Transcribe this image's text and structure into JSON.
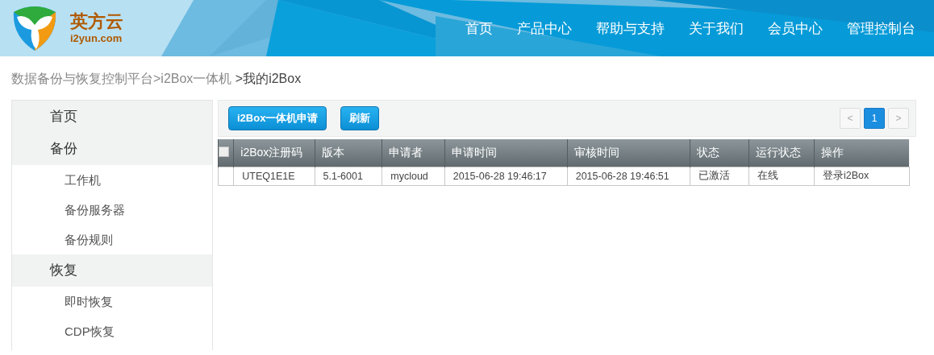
{
  "logo": {
    "name": "英方云",
    "domain": "i2yun.com"
  },
  "nav": [
    {
      "label": "首页"
    },
    {
      "label": "产品中心"
    },
    {
      "label": "帮助与支持"
    },
    {
      "label": "关于我们"
    },
    {
      "label": "会员中心"
    },
    {
      "label": "管理控制台"
    }
  ],
  "breadcrumb": [
    {
      "label": "数据备份与恢复控制平台>",
      "current": false
    },
    {
      "label": "i2Box一体机 ",
      "current": false
    },
    {
      "label": ">我的i2Box",
      "current": true
    }
  ],
  "sidebar": {
    "items": [
      {
        "label": "首页"
      },
      {
        "label": "备份",
        "children": [
          {
            "label": "工作机"
          },
          {
            "label": "备份服务器"
          },
          {
            "label": "备份规则"
          }
        ]
      },
      {
        "label": "恢复",
        "children": [
          {
            "label": "即时恢复"
          },
          {
            "label": "CDP恢复"
          }
        ]
      }
    ]
  },
  "toolbar": {
    "buttons": [
      "i2Box一体机申请",
      "刷新"
    ]
  },
  "pagination": {
    "prev": "<",
    "next": ">",
    "pages": [
      {
        "label": "1",
        "selected": true
      }
    ]
  },
  "table": {
    "select_all": {
      "checked": false
    },
    "columns": [
      "i2Box注册码",
      "版本",
      "申请者",
      "申请时间",
      "审核时间",
      "状态",
      "运行状态",
      "操作"
    ],
    "rows": [
      {
        "cells": [
          "UTEQ1E1E",
          "5.1-6001",
          "mycloud",
          "2015-06-28 19:46:17",
          "2015-06-28 19:46:51",
          "已激活",
          "在线",
          "登录i2Box"
        ]
      }
    ]
  }
}
